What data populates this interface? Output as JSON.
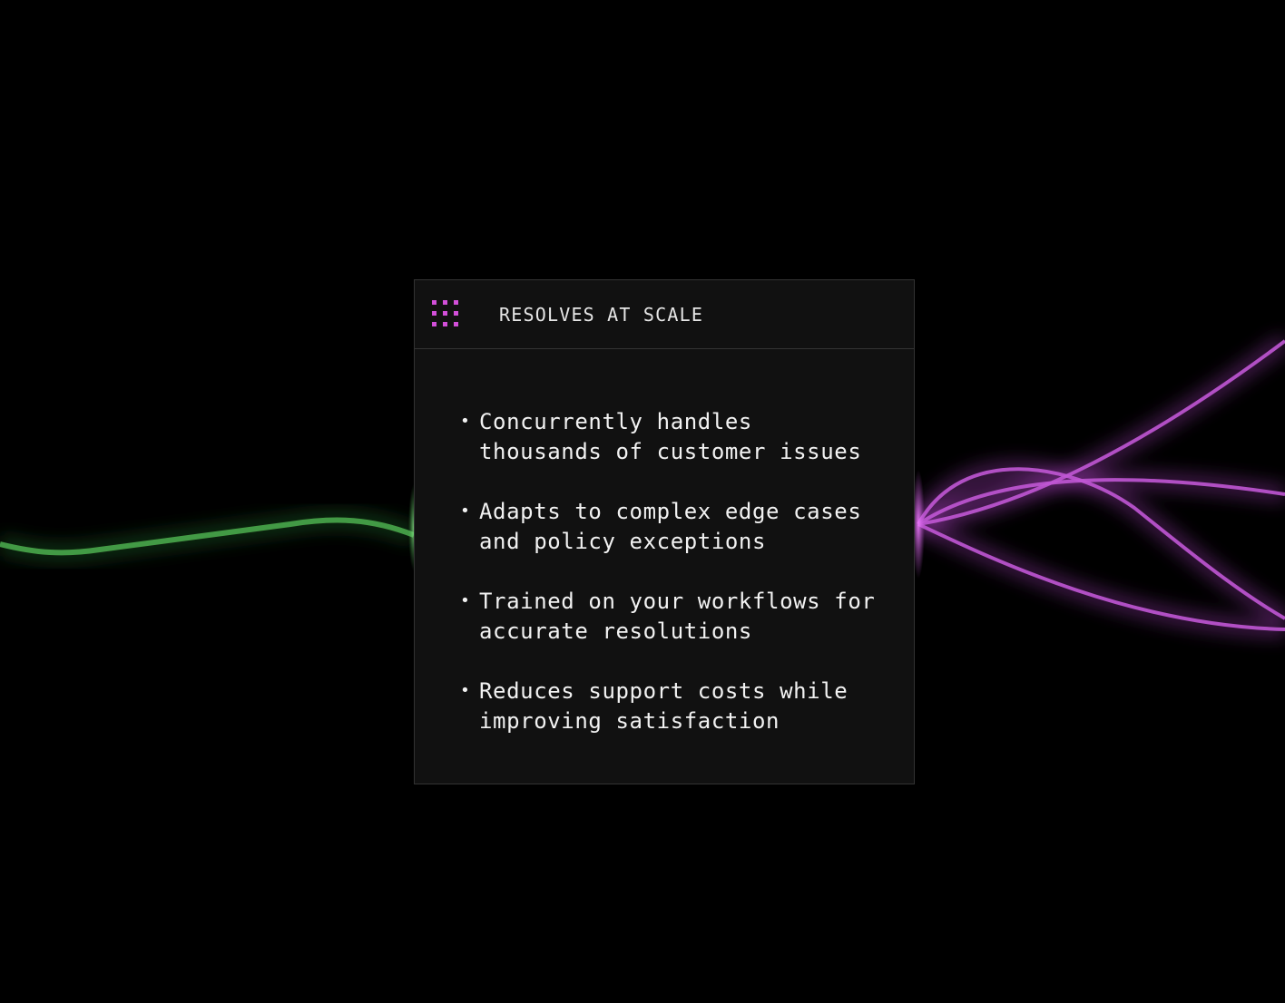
{
  "card": {
    "title": "RESOLVES AT SCALE",
    "icon": "grid-dots-icon",
    "icon_color": "#d24fd9",
    "features": [
      {
        "line1": "Concurrently handles",
        "line2": "thousands of customer issues"
      },
      {
        "line1": "Adapts to complex edge cases",
        "line2": "and policy exceptions"
      },
      {
        "line1": "Trained on your workflows for",
        "line2": "accurate resolutions"
      },
      {
        "line1": "Reduces support costs while",
        "line2": "improving satisfaction"
      }
    ],
    "bullet": "•"
  },
  "colors": {
    "background": "#000000",
    "card_background": "#111111",
    "card_border": "#333333",
    "input_wire": "#4caf50",
    "output_wire": "#c056d4"
  }
}
